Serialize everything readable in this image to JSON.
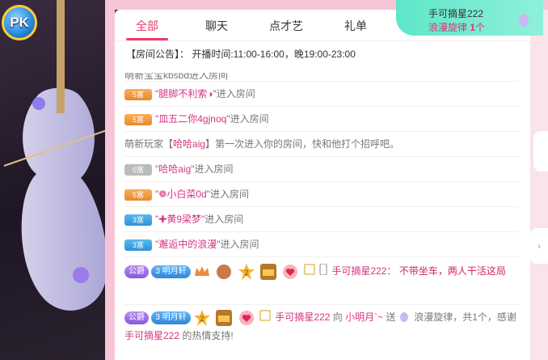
{
  "tabs": [
    {
      "label": "全部"
    },
    {
      "label": "聊天"
    },
    {
      "label": "点才艺"
    },
    {
      "label": "礼单"
    }
  ],
  "gift_popup": {
    "sender": "手可摘星222",
    "gift": "浪漫旋律",
    "count": "1",
    "unit": "个"
  },
  "notice": "【房间公告】： 开播时间:11:00-16:00，晚19:00-23:00",
  "rows": [
    {
      "text_partial": "萌新宝宝kbsbd进入房间"
    },
    {
      "badge": "5富",
      "user": "\"腿脚不利索◑\"",
      "suffix": "进入房间"
    },
    {
      "badge": "5富",
      "user": "\"皿五二你4gjnoq\"",
      "suffix": "进入房间"
    },
    {
      "welcome_prefix": "萌新玩家【",
      "welcome_user": "哈哈aig",
      "welcome_suffix": "】第一次进入你的房间，快和他打个招呼吧。"
    },
    {
      "badge": "0富",
      "user": "\"哈哈aig\"",
      "suffix": "进入房间"
    },
    {
      "badge": "5富",
      "user": "\"❁小白菜0d\"",
      "suffix": "进入房间"
    },
    {
      "badge": "3富",
      "user": "\"✚黄9梁梦\"",
      "suffix": "进入房间"
    },
    {
      "badge": "3富",
      "user": "\"邂逅中的浪漫\"",
      "suffix": "进入房间"
    }
  ],
  "msg1": {
    "title_badge": "公爵",
    "fan_badge": "明月轩",
    "fan_level": "3",
    "level": "2",
    "sender": "手可摘星222",
    "sep": "：",
    "content": "不带坐车，两人干活这局"
  },
  "msg2": {
    "title_badge": "公爵",
    "fan_badge": "明月轩",
    "fan_level": "3",
    "level": "2",
    "sender": "手可摘星222",
    "to": "向",
    "receiver": "小明月`~",
    "send": "送",
    "gift": "浪漫旋律，共1个，感谢",
    "thanks_user": "手可摘星222",
    "thanks_suffix": "的热情支持!"
  },
  "pk_label": "PK",
  "colors": {
    "accent": "#ef3a6a",
    "popup": "#6fe9cf"
  }
}
